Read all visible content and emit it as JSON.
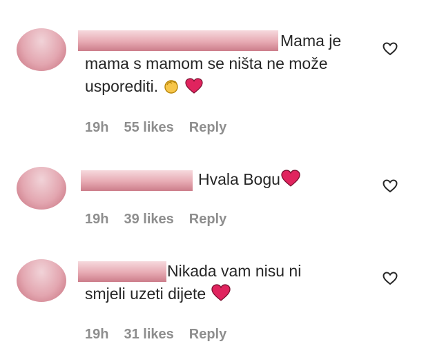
{
  "comments": [
    {
      "text_first": "Mama je",
      "text_rest": "mama s mamom se ništa ne može usporediti.",
      "emojis": [
        "clapping-hands",
        "red-heart"
      ],
      "time": "19h",
      "likes": "55 likes",
      "reply": "Reply"
    },
    {
      "text_first": "Hvala Bogu",
      "text_rest": "",
      "emojis": [
        "red-heart"
      ],
      "time": "19h",
      "likes": "39 likes",
      "reply": "Reply"
    },
    {
      "text_first": "Nikada vam nisu ni",
      "text_rest": "smjeli uzeti dijete",
      "emojis": [
        "red-heart"
      ],
      "time": "19h",
      "likes": "31 likes",
      "reply": "Reply"
    }
  ],
  "icons": {
    "like": "heart-outline-icon"
  },
  "colors": {
    "meta": "#8e8e8e",
    "text": "#262626",
    "heart": "#e0245e"
  }
}
